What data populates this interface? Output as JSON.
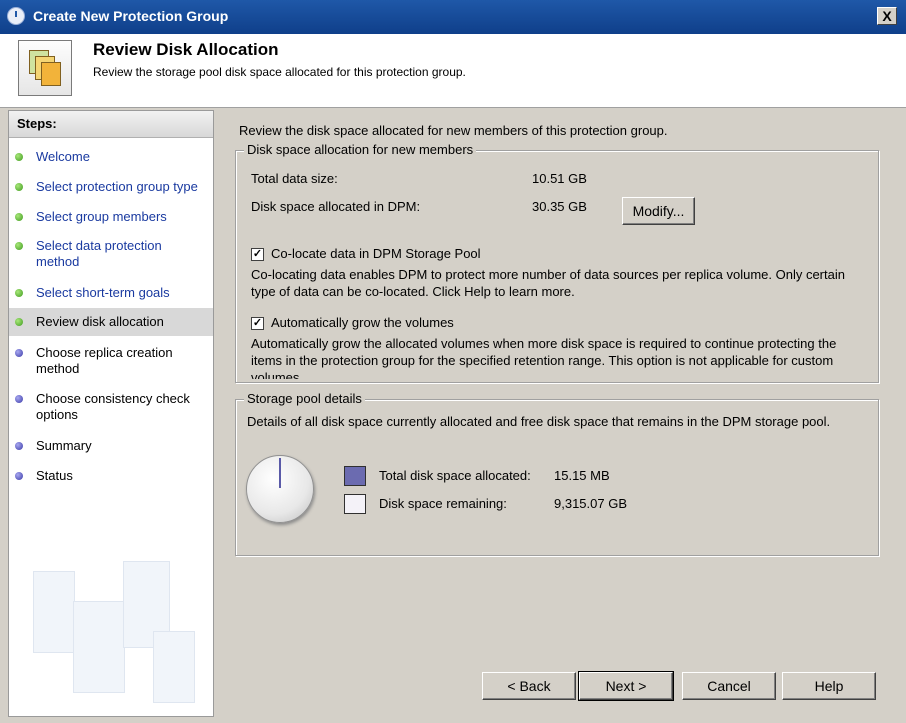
{
  "window": {
    "title": "Create New Protection Group",
    "close_label": "X"
  },
  "header": {
    "title": "Review Disk Allocation",
    "subtitle": "Review the storage pool disk space allocated for this protection group."
  },
  "sidebar": {
    "heading": "Steps:",
    "items": [
      {
        "label": "Welcome",
        "state": "done"
      },
      {
        "label": "Select protection group type",
        "state": "done"
      },
      {
        "label": "Select group members",
        "state": "done"
      },
      {
        "label": "Select data protection method",
        "state": "done"
      },
      {
        "label": "Select short-term goals",
        "state": "done"
      },
      {
        "label": "Review disk allocation",
        "state": "current"
      },
      {
        "label": "Choose replica creation method",
        "state": "pending"
      },
      {
        "label": "Choose consistency check options",
        "state": "pending"
      },
      {
        "label": "Summary",
        "state": "pending"
      },
      {
        "label": "Status",
        "state": "pending"
      }
    ]
  },
  "main": {
    "intro": "Review the disk space allocated for new members of this protection group.",
    "allocation": {
      "legend": "Disk space allocation for new members",
      "total_label": "Total data size:",
      "total_value": "10.51 GB",
      "allocated_label": "Disk space allocated in DPM:",
      "allocated_value": "30.35 GB",
      "modify_label": "Modify...",
      "colocate": {
        "checked": true,
        "label": "Co-locate data in DPM Storage Pool",
        "desc": "Co-locating data enables DPM to protect more number of data sources per replica volume. Only certain type of data can be co-located. Click Help to learn more."
      },
      "autogrow": {
        "checked": true,
        "label": "Automatically grow the volumes",
        "desc": "Automatically grow the allocated volumes when more disk space is required to continue protecting the items in the protection group for the specified retention range. This option is not applicable for custom volumes."
      }
    },
    "storage": {
      "legend": "Storage pool details",
      "desc": "Details of all disk space currently allocated and free disk space that remains in the DPM storage pool.",
      "allocated_label": "Total disk space allocated:",
      "allocated_value": "15.15 MB",
      "allocated_color": "#6b6bb0",
      "remaining_label": "Disk space remaining:",
      "remaining_value": "9,315.07 GB",
      "remaining_color": "#f4f2f8"
    }
  },
  "buttons": {
    "back": "< Back",
    "next": "Next >",
    "cancel": "Cancel",
    "help": "Help"
  }
}
